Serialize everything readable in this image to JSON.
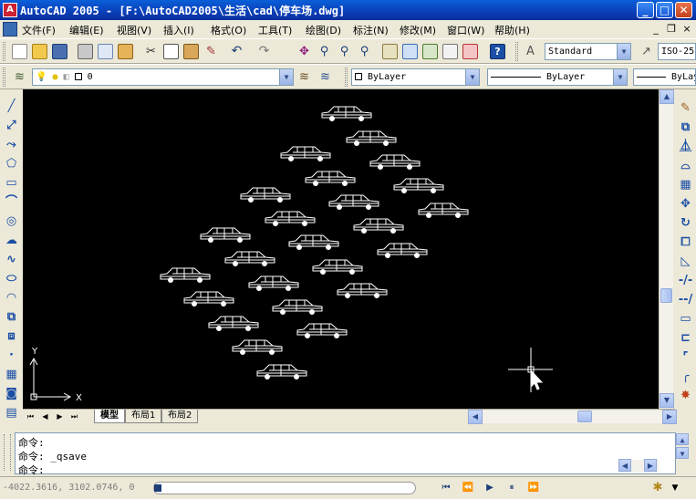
{
  "window": {
    "title": "AutoCAD 2005 - [F:\\AutoCAD2005\\生活\\cad\\停车场.dwg]",
    "min_glyph": "_",
    "max_glyph": "□",
    "close_glyph": "✕"
  },
  "menu": {
    "items": [
      "文件(F)",
      "编辑(E)",
      "视图(V)",
      "插入(I)",
      "格式(O)",
      "工具(T)",
      "绘图(D)",
      "标注(N)",
      "修改(M)",
      "窗口(W)",
      "帮助(H)"
    ],
    "mdi_min": "_",
    "mdi_restore": "❐",
    "mdi_close": "×"
  },
  "toolbar": {
    "text_style": "Standard",
    "dim_style": "ISO-25"
  },
  "layer_bar": {
    "layer_name": "0",
    "color": "ByLayer",
    "linetype": "ByLayer",
    "lineweight": "ByLay"
  },
  "tabs": {
    "items": [
      "模型",
      "布局1",
      "布局2"
    ],
    "active": 0
  },
  "ucs": {
    "x_label": "X",
    "y_label": "Y"
  },
  "command": {
    "lines": [
      "命令:",
      "命令: _qsave",
      "命令:"
    ]
  },
  "status": {
    "coordinates": "-4022.3616, 3102.0746, 0"
  },
  "colors": {
    "canvas": "#000000",
    "titlebar": "#0a5fd8",
    "entity": "#ffffff"
  },
  "icons": {
    "left_tools": [
      "line-icon",
      "construction-line-icon",
      "polyline-icon",
      "polygon-icon",
      "rectangle-icon",
      "arc-icon",
      "circle-icon",
      "revcloud-icon",
      "spline-icon",
      "ellipse-icon",
      "ellipse-arc-icon",
      "insert-block-icon",
      "make-block-icon",
      "point-icon",
      "hatch-icon",
      "region-icon",
      "table-icon"
    ],
    "right_tools": [
      "erase-icon",
      "copy-icon",
      "mirror-icon",
      "offset-icon",
      "array-icon",
      "move-icon",
      "rotate-icon",
      "scale-icon",
      "stretch-icon",
      "trim-icon",
      "extend-icon",
      "break-icon",
      "break-at-point-icon",
      "chamfer-icon",
      "fillet-icon",
      "explode-icon"
    ]
  }
}
